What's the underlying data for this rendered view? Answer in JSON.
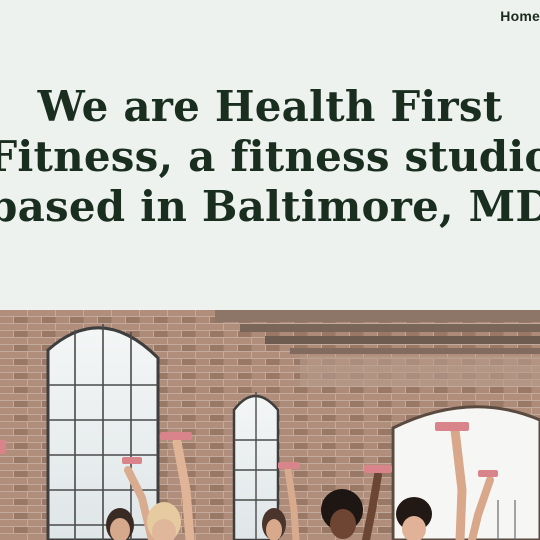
{
  "nav": {
    "items": [
      {
        "label": "Home"
      }
    ]
  },
  "hero": {
    "heading_lines": [
      "We are Health First",
      "Fitness, a fitness studio",
      "based in Baltimore, MD"
    ]
  },
  "photo": {
    "icon": "fitness-class-photo"
  },
  "colors": {
    "background": "#eef2ee",
    "heading": "#1a2e1f",
    "nav_text": "#1c2a1e",
    "brick": "#a48270",
    "dumbbell": "#d8848a"
  }
}
